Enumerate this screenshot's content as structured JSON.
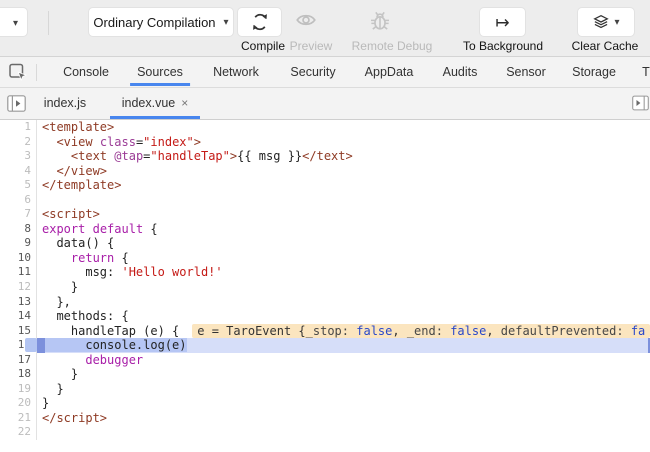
{
  "toolbar": {
    "device_dropdown_caret": "▾",
    "mode_button": {
      "label": "Ordinary Compilation",
      "caret": "▾"
    },
    "actions": [
      {
        "label": "Compile",
        "icon": "refresh-icon",
        "enabled": true
      },
      {
        "label": "Preview",
        "icon": "eye-icon",
        "enabled": false
      },
      {
        "label": "Remote Debug",
        "icon": "bug-icon",
        "enabled": false
      },
      {
        "label": "To Background",
        "icon": "maps-to-icon",
        "enabled": true,
        "glyph": "↦"
      },
      {
        "label": "Clear Cache",
        "icon": "layers-icon",
        "enabled": true,
        "caret": "▾"
      }
    ]
  },
  "devtools_tabs": {
    "active": "Sources",
    "items": [
      "Console",
      "Sources",
      "Network",
      "Security",
      "AppData",
      "Audits",
      "Sensor",
      "Storage",
      "T"
    ]
  },
  "file_tabs": {
    "items": [
      {
        "label": "index.js",
        "active": false
      },
      {
        "label": "index.vue",
        "active": true,
        "close": "×"
      }
    ]
  },
  "editor": {
    "lines": [
      {
        "n": 1,
        "dim": true,
        "seg": [
          [
            "t",
            "<template>"
          ]
        ]
      },
      {
        "n": 2,
        "dim": true,
        "seg": [
          [
            "p",
            "  "
          ],
          [
            "t",
            "<view "
          ],
          [
            "a",
            "class"
          ],
          [
            "p",
            "="
          ],
          [
            "s",
            "\"index\""
          ],
          [
            "t",
            ">"
          ]
        ]
      },
      {
        "n": 3,
        "dim": true,
        "seg": [
          [
            "p",
            "    "
          ],
          [
            "t",
            "<text "
          ],
          [
            "a",
            "@tap"
          ],
          [
            "p",
            "="
          ],
          [
            "s",
            "\"handleTap\""
          ],
          [
            "t",
            ">"
          ],
          [
            "p",
            "{{ msg }}"
          ],
          [
            "t",
            "</text>"
          ]
        ]
      },
      {
        "n": 4,
        "dim": true,
        "seg": [
          [
            "p",
            "  "
          ],
          [
            "t",
            "</view>"
          ]
        ]
      },
      {
        "n": 5,
        "dim": true,
        "seg": [
          [
            "t",
            "</template>"
          ]
        ]
      },
      {
        "n": 6,
        "dim": true,
        "seg": []
      },
      {
        "n": 7,
        "dim": true,
        "seg": [
          [
            "t",
            "<script>"
          ]
        ]
      },
      {
        "n": 8,
        "dim": false,
        "seg": [
          [
            "k",
            "export"
          ],
          [
            "p",
            " "
          ],
          [
            "k",
            "default"
          ],
          [
            "p",
            " {"
          ]
        ]
      },
      {
        "n": 9,
        "dim": false,
        "seg": [
          [
            "p",
            "  data() {"
          ]
        ]
      },
      {
        "n": 10,
        "dim": false,
        "seg": [
          [
            "p",
            "    "
          ],
          [
            "k",
            "return"
          ],
          [
            "p",
            " {"
          ]
        ]
      },
      {
        "n": 11,
        "dim": false,
        "seg": [
          [
            "p",
            "      msg: "
          ],
          [
            "s",
            "'Hello world!'"
          ]
        ]
      },
      {
        "n": 12,
        "dim": true,
        "seg": [
          [
            "p",
            "    }"
          ]
        ]
      },
      {
        "n": 13,
        "dim": false,
        "seg": [
          [
            "p",
            "  },"
          ]
        ]
      },
      {
        "n": 14,
        "dim": false,
        "seg": [
          [
            "p",
            "  methods: {"
          ]
        ]
      },
      {
        "n": 15,
        "dim": false,
        "seg": [
          [
            "p",
            "    handleTap (e) {"
          ]
        ],
        "inline": [
          [
            "p",
            "e = TaroEvent {"
          ],
          [
            "n",
            "_stop:"
          ],
          [
            "p",
            " "
          ],
          [
            "v",
            "false"
          ],
          [
            "p",
            ", "
          ],
          [
            "n",
            "_end:"
          ],
          [
            "p",
            " "
          ],
          [
            "v",
            "false"
          ],
          [
            "p",
            ", "
          ],
          [
            "n",
            "defaultPrevented:"
          ],
          [
            "p",
            " "
          ],
          [
            "v",
            "fa"
          ]
        ]
      },
      {
        "n": 16,
        "dim": false,
        "exec": true,
        "seg": [
          [
            "sel",
            "      console.log(e)"
          ]
        ]
      },
      {
        "n": 17,
        "dim": false,
        "seg": [
          [
            "p",
            "      "
          ],
          [
            "k",
            "debugger"
          ]
        ]
      },
      {
        "n": 18,
        "dim": false,
        "seg": [
          [
            "p",
            "    }"
          ]
        ]
      },
      {
        "n": 19,
        "dim": true,
        "seg": [
          [
            "p",
            "  }"
          ]
        ]
      },
      {
        "n": 20,
        "dim": true,
        "seg": [
          [
            "p",
            "}"
          ]
        ]
      },
      {
        "n": 21,
        "dim": true,
        "seg": [
          [
            "t",
            "</script>"
          ]
        ]
      },
      {
        "n": 22,
        "dim": true,
        "seg": []
      }
    ]
  },
  "colors": {
    "accent_blue": "#4886ee",
    "toolbar_bg": "#ededed",
    "tabbar_bg": "#f3f3f3",
    "exec_line_bg": "#d6def9",
    "exec_selection_bg": "#b6c6f4",
    "exec_marker": "#7c90dc",
    "inline_value_bg": "#fbe5bf",
    "syntax": {
      "tag": "#8e3a24",
      "attribute": "#9b3c96",
      "keyword": "#a81ea8",
      "string": "#c41a16",
      "plain": "#232323",
      "boolean": "#2847c9"
    }
  }
}
